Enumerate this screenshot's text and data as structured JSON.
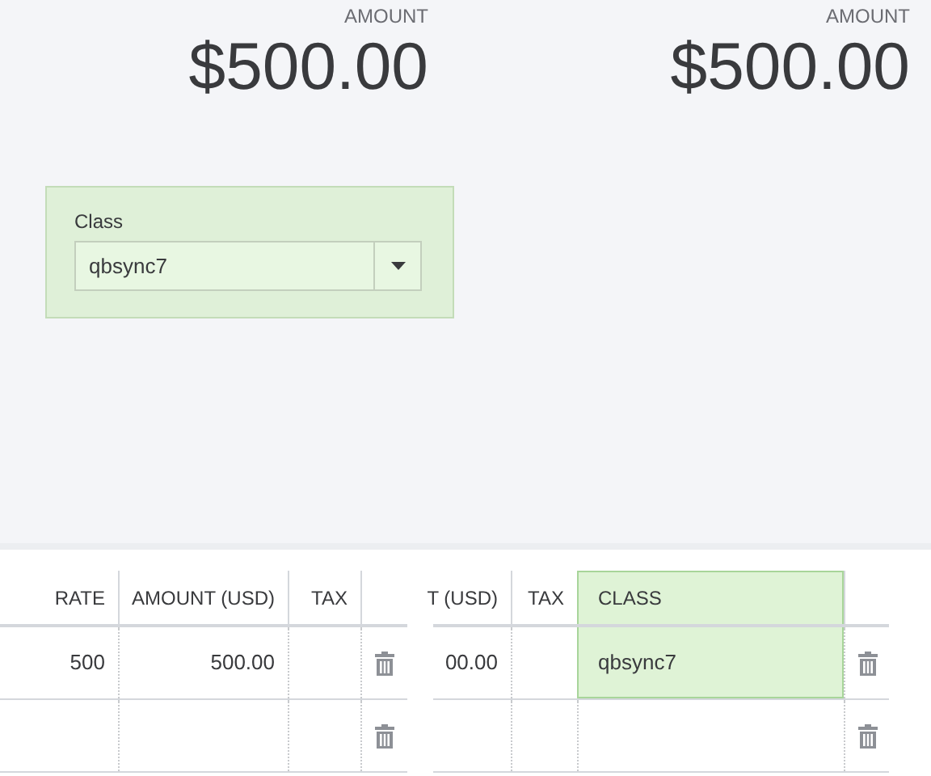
{
  "panels": [
    {
      "amount_label": "AMOUNT",
      "amount": "$500.00",
      "class_field": {
        "label": "Class",
        "value": "qbsync7"
      }
    },
    {
      "amount_label": "AMOUNT",
      "amount": "$500.00"
    }
  ],
  "tables": [
    {
      "columns": [
        {
          "kind": "text",
          "label": "RATE",
          "highlighted": false
        },
        {
          "kind": "text",
          "label": "AMOUNT (USD)",
          "highlighted": false
        },
        {
          "kind": "text",
          "label": "TAX",
          "highlighted": false
        },
        {
          "kind": "trash"
        }
      ],
      "rows": [
        {
          "cells": [
            {
              "text": "500"
            },
            {
              "text": "500.00"
            },
            {},
            {}
          ]
        },
        {
          "cells": [
            {},
            {},
            {},
            {}
          ]
        }
      ]
    },
    {
      "columns": [
        {
          "kind": "text",
          "label": "T (USD)",
          "highlighted": false
        },
        {
          "kind": "text",
          "label": "TAX",
          "highlighted": false
        },
        {
          "kind": "text_left",
          "label": "CLASS",
          "highlighted": true
        },
        {
          "kind": "trash"
        }
      ],
      "rows": [
        {
          "cells": [
            {
              "text": "00.00"
            },
            {},
            {
              "text": "qbsync7",
              "highlighted": true
            },
            {}
          ]
        },
        {
          "cells": [
            {},
            {},
            {},
            {}
          ]
        }
      ]
    }
  ]
}
